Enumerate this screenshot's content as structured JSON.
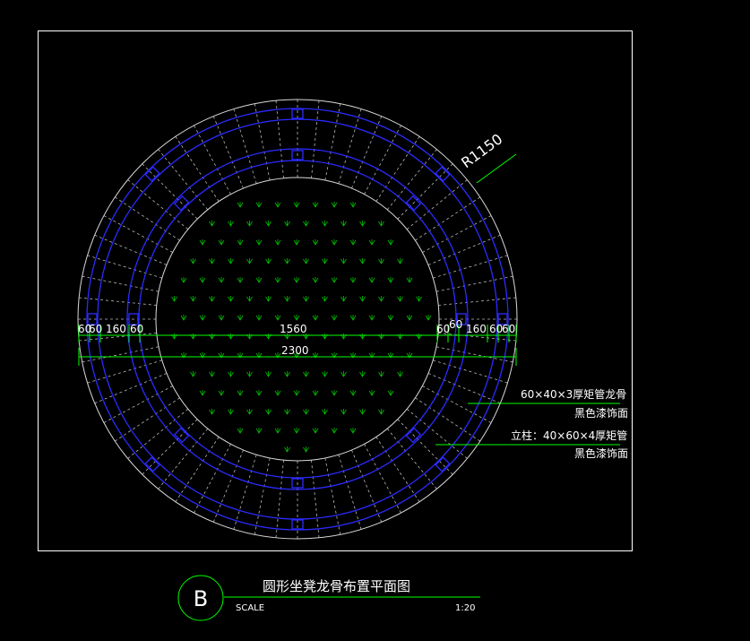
{
  "drawing": {
    "radius_label": "R1150",
    "dimensions": {
      "top_row_left": [
        "60",
        "60",
        "160",
        "60"
      ],
      "top_row_center": "1560",
      "top_row_right": [
        "60",
        "60",
        "160",
        "60",
        "60"
      ],
      "overall": "2300"
    },
    "annotations": {
      "callout1_line1": "60×40×3厚矩管龙骨",
      "callout1_line2": "黑色漆饰面",
      "callout2_line1": "立柱：40×60×4厚矩管",
      "callout2_line2": "黑色漆饰面"
    },
    "colors": {
      "background": "#000000",
      "frame": "#ffffff",
      "outline": "#d9d9d9",
      "steel": "#2b2bff",
      "dimension": "#00ff00",
      "grass": "#00c000"
    }
  },
  "title_block": {
    "label": "B",
    "title": "圆形坐凳龙骨布置平面图",
    "scale_label": "SCALE",
    "scale_value": "1:20"
  }
}
